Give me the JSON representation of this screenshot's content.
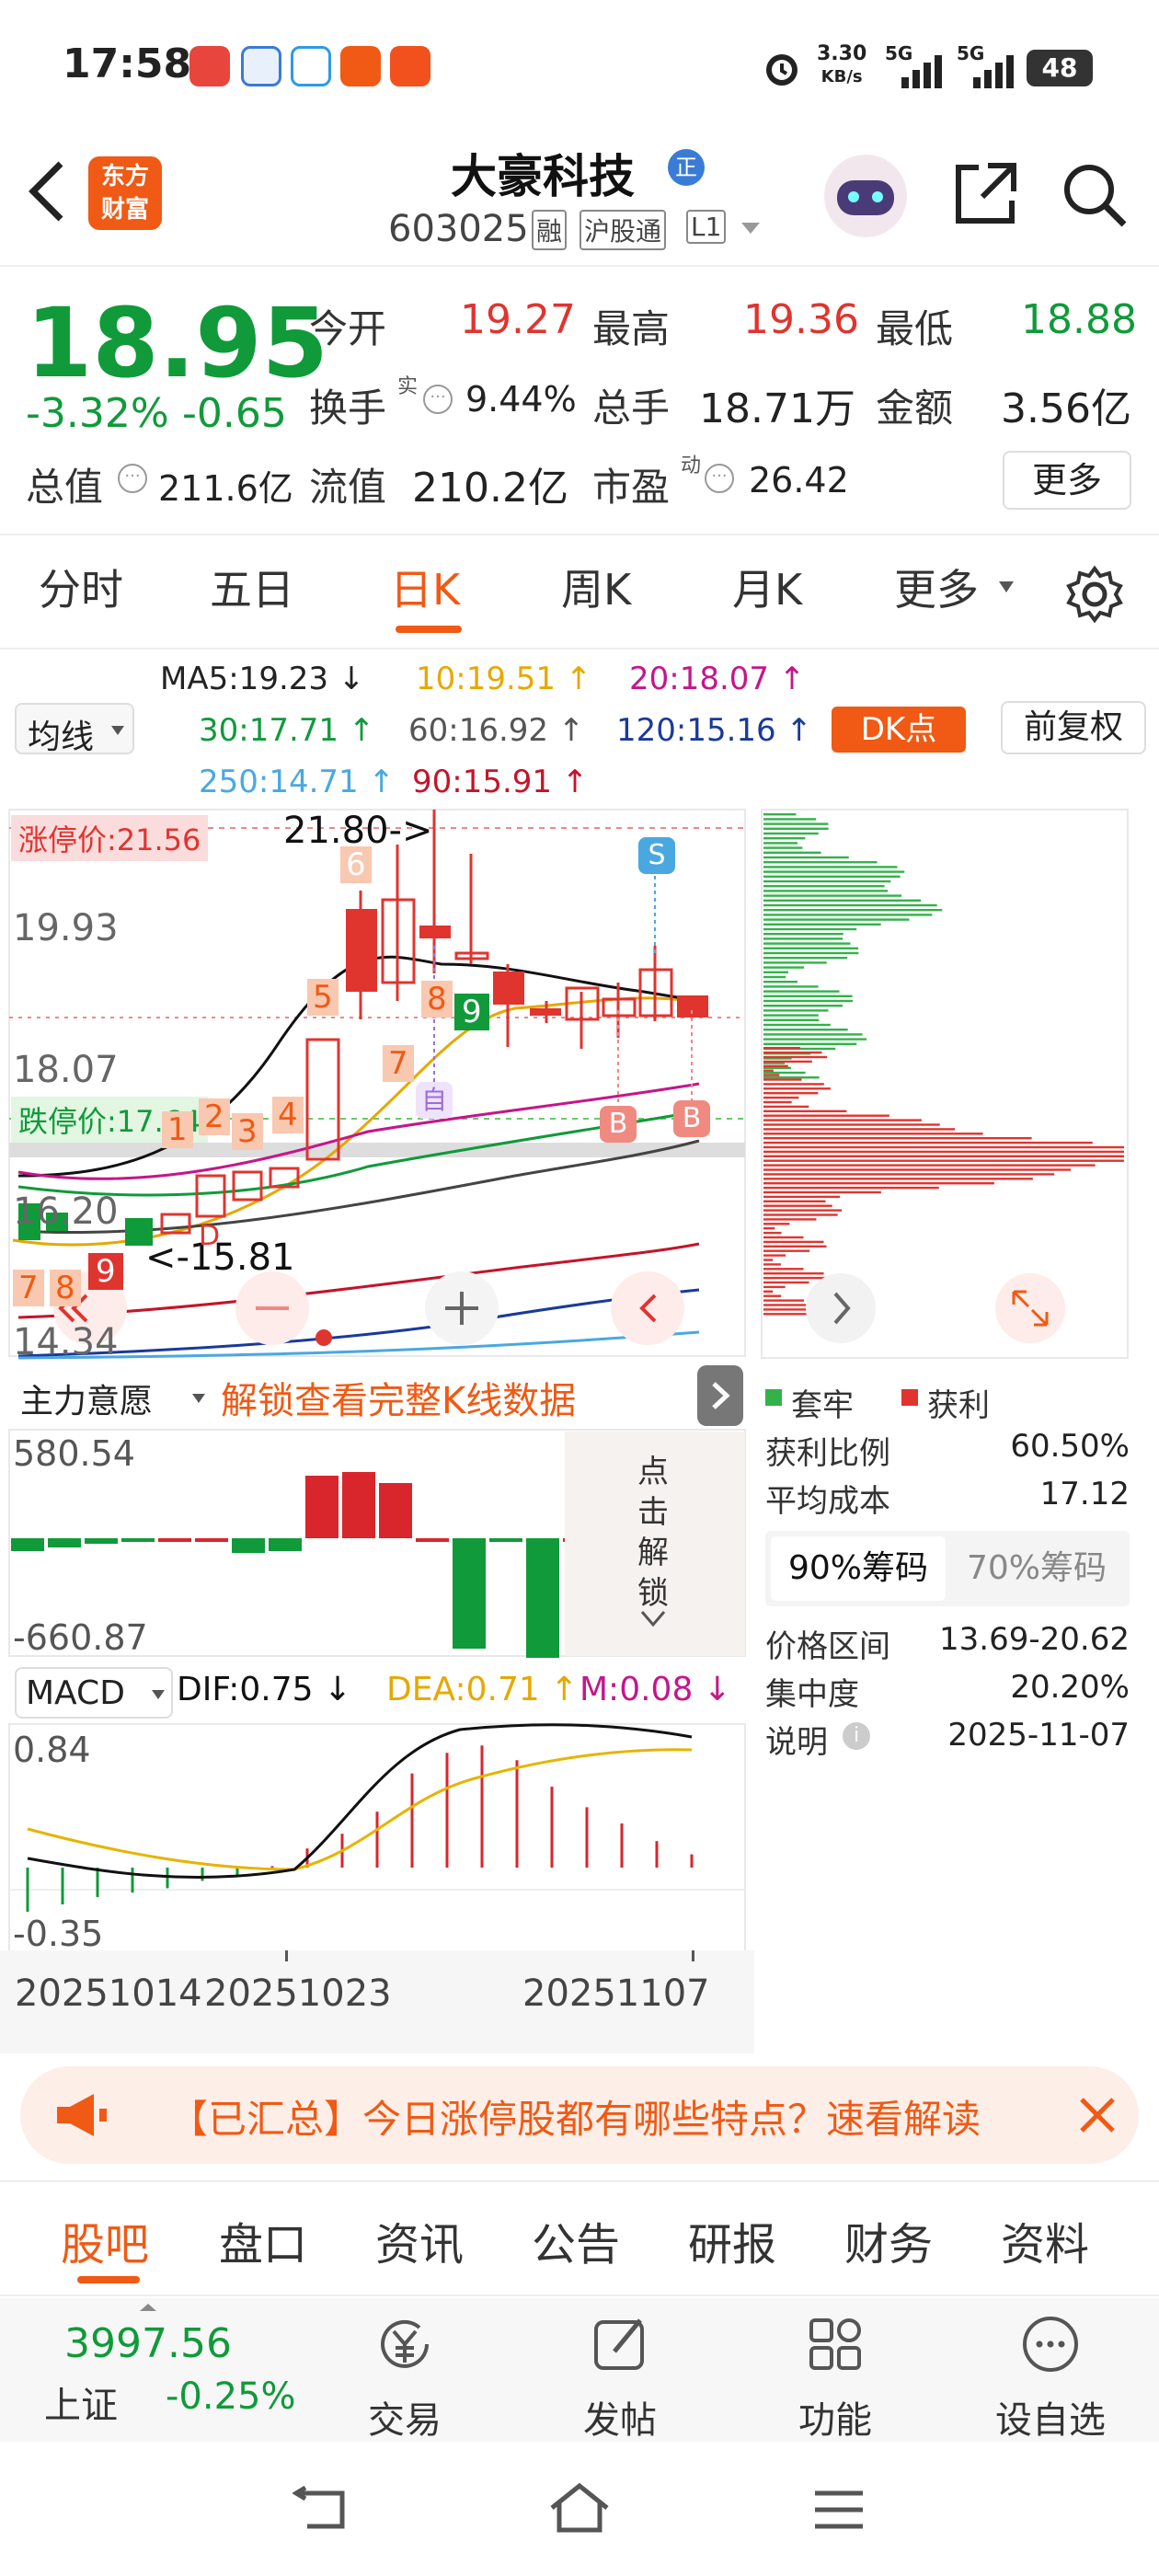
{
  "status": {
    "time": "17:58",
    "net_speed": "3.30",
    "net_unit": "KB/s",
    "sig1": "5G",
    "sig2": "5G",
    "battery": "48"
  },
  "header": {
    "logo_line1": "东方",
    "logo_line2": "财富",
    "stock_name": "大豪科技",
    "badge": "正",
    "code": "603025",
    "tag1": "融",
    "tag2": "沪股通",
    "tag3": "L1"
  },
  "quote": {
    "price": "18.95",
    "pct": "-3.32%",
    "chg": "-0.65",
    "open_label": "今开",
    "open": "19.27",
    "high_label": "最高",
    "high": "19.36",
    "low_label": "最低",
    "low": "18.88",
    "turnover_label": "换手",
    "turnover_sup": "实",
    "turnover": "9.44%",
    "vol_label": "总手",
    "vol": "18.71万",
    "amt_label": "金额",
    "amt": "3.56亿",
    "mcap_label": "总值",
    "mcap": "211.6亿",
    "float_label": "流值",
    "float": "210.2亿",
    "pe_label": "市盈",
    "pe_sup": "动",
    "pe": "26.42",
    "more_label": "更多"
  },
  "tabs": [
    "分时",
    "五日",
    "日K",
    "周K",
    "月K",
    "更多"
  ],
  "ma": {
    "select_label": "均线",
    "ma5": "MA5:19.23 ↓",
    "ma10": "10:19.51 ↑",
    "ma20": "20:18.07 ↑",
    "ma30": "30:17.71 ↑",
    "ma60": "60:16.92 ↑",
    "ma120": "120:15.16 ↑",
    "ma250": "250:14.71 ↑",
    "ma90": "90:15.91 ↑",
    "dk_label": "DK点",
    "fq_label": "前复权"
  },
  "kchart": {
    "limit_up": "涨停价:21.56",
    "limit_down": "跌停价:17.64",
    "peak_note": "21.80->",
    "low_note": "<-15.81",
    "y1": "19.93",
    "y2": "18.07",
    "y3": "16.20",
    "y4": "14.34",
    "signals": [
      "6",
      "5",
      "8",
      "9",
      "7",
      "1",
      "2",
      "3",
      "4",
      "7",
      "8",
      "9"
    ],
    "sell_tag": "S",
    "buy_tag": "B",
    "self_tag": "自",
    "d_tag": "D"
  },
  "capital": {
    "select_label": "主力意愿",
    "unlock_text": "解锁查看完整K线数据",
    "max": "580.54",
    "min": "-660.87",
    "side_text": "点击解锁"
  },
  "macd": {
    "select_label": "MACD",
    "dif": "DIF:0.75 ↓",
    "dea": "DEA:0.71 ↑",
    "m": "M:0.08 ↓",
    "top": "0.84",
    "bottom": "-0.35",
    "dates": [
      "20251014",
      "20251023",
      "20251107"
    ]
  },
  "chips": {
    "legend_trapped": "套牢",
    "legend_profit": "获利",
    "rows": [
      [
        "获利比例",
        "60.50%"
      ],
      [
        "平均成本",
        "17.12"
      ]
    ],
    "tab90": "90%筹码",
    "tab70": "70%筹码",
    "rows2": [
      [
        "价格区间",
        "13.69-20.62"
      ],
      [
        "集中度",
        "20.20%"
      ],
      [
        "说明",
        "2025-11-07"
      ]
    ]
  },
  "banner": {
    "text": "【已汇总】今日涨停股都有哪些特点？速看解读"
  },
  "bottom_tabs": [
    "股吧",
    "盘口",
    "资讯",
    "公告",
    "研报",
    "财务",
    "资料"
  ],
  "index": {
    "value": "3997.56",
    "name": "上证",
    "pct": "-0.25%"
  },
  "nav": [
    "交易",
    "发帖",
    "功能",
    "设自选"
  ],
  "colors": {
    "up": "#e0342f",
    "down": "#109a3a",
    "accent": "#f05a14"
  }
}
